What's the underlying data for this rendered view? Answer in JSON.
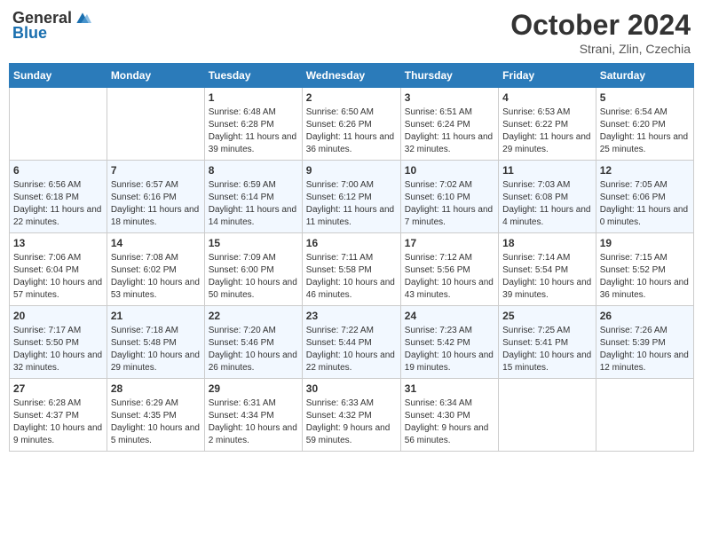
{
  "header": {
    "logo_general": "General",
    "logo_blue": "Blue",
    "month_title": "October 2024",
    "subtitle": "Strani, Zlin, Czechia"
  },
  "weekdays": [
    "Sunday",
    "Monday",
    "Tuesday",
    "Wednesday",
    "Thursday",
    "Friday",
    "Saturday"
  ],
  "weeks": [
    [
      {
        "day": "",
        "info": ""
      },
      {
        "day": "",
        "info": ""
      },
      {
        "day": "1",
        "info": "Sunrise: 6:48 AM\nSunset: 6:28 PM\nDaylight: 11 hours and 39 minutes."
      },
      {
        "day": "2",
        "info": "Sunrise: 6:50 AM\nSunset: 6:26 PM\nDaylight: 11 hours and 36 minutes."
      },
      {
        "day": "3",
        "info": "Sunrise: 6:51 AM\nSunset: 6:24 PM\nDaylight: 11 hours and 32 minutes."
      },
      {
        "day": "4",
        "info": "Sunrise: 6:53 AM\nSunset: 6:22 PM\nDaylight: 11 hours and 29 minutes."
      },
      {
        "day": "5",
        "info": "Sunrise: 6:54 AM\nSunset: 6:20 PM\nDaylight: 11 hours and 25 minutes."
      }
    ],
    [
      {
        "day": "6",
        "info": "Sunrise: 6:56 AM\nSunset: 6:18 PM\nDaylight: 11 hours and 22 minutes."
      },
      {
        "day": "7",
        "info": "Sunrise: 6:57 AM\nSunset: 6:16 PM\nDaylight: 11 hours and 18 minutes."
      },
      {
        "day": "8",
        "info": "Sunrise: 6:59 AM\nSunset: 6:14 PM\nDaylight: 11 hours and 14 minutes."
      },
      {
        "day": "9",
        "info": "Sunrise: 7:00 AM\nSunset: 6:12 PM\nDaylight: 11 hours and 11 minutes."
      },
      {
        "day": "10",
        "info": "Sunrise: 7:02 AM\nSunset: 6:10 PM\nDaylight: 11 hours and 7 minutes."
      },
      {
        "day": "11",
        "info": "Sunrise: 7:03 AM\nSunset: 6:08 PM\nDaylight: 11 hours and 4 minutes."
      },
      {
        "day": "12",
        "info": "Sunrise: 7:05 AM\nSunset: 6:06 PM\nDaylight: 11 hours and 0 minutes."
      }
    ],
    [
      {
        "day": "13",
        "info": "Sunrise: 7:06 AM\nSunset: 6:04 PM\nDaylight: 10 hours and 57 minutes."
      },
      {
        "day": "14",
        "info": "Sunrise: 7:08 AM\nSunset: 6:02 PM\nDaylight: 10 hours and 53 minutes."
      },
      {
        "day": "15",
        "info": "Sunrise: 7:09 AM\nSunset: 6:00 PM\nDaylight: 10 hours and 50 minutes."
      },
      {
        "day": "16",
        "info": "Sunrise: 7:11 AM\nSunset: 5:58 PM\nDaylight: 10 hours and 46 minutes."
      },
      {
        "day": "17",
        "info": "Sunrise: 7:12 AM\nSunset: 5:56 PM\nDaylight: 10 hours and 43 minutes."
      },
      {
        "day": "18",
        "info": "Sunrise: 7:14 AM\nSunset: 5:54 PM\nDaylight: 10 hours and 39 minutes."
      },
      {
        "day": "19",
        "info": "Sunrise: 7:15 AM\nSunset: 5:52 PM\nDaylight: 10 hours and 36 minutes."
      }
    ],
    [
      {
        "day": "20",
        "info": "Sunrise: 7:17 AM\nSunset: 5:50 PM\nDaylight: 10 hours and 32 minutes."
      },
      {
        "day": "21",
        "info": "Sunrise: 7:18 AM\nSunset: 5:48 PM\nDaylight: 10 hours and 29 minutes."
      },
      {
        "day": "22",
        "info": "Sunrise: 7:20 AM\nSunset: 5:46 PM\nDaylight: 10 hours and 26 minutes."
      },
      {
        "day": "23",
        "info": "Sunrise: 7:22 AM\nSunset: 5:44 PM\nDaylight: 10 hours and 22 minutes."
      },
      {
        "day": "24",
        "info": "Sunrise: 7:23 AM\nSunset: 5:42 PM\nDaylight: 10 hours and 19 minutes."
      },
      {
        "day": "25",
        "info": "Sunrise: 7:25 AM\nSunset: 5:41 PM\nDaylight: 10 hours and 15 minutes."
      },
      {
        "day": "26",
        "info": "Sunrise: 7:26 AM\nSunset: 5:39 PM\nDaylight: 10 hours and 12 minutes."
      }
    ],
    [
      {
        "day": "27",
        "info": "Sunrise: 6:28 AM\nSunset: 4:37 PM\nDaylight: 10 hours and 9 minutes."
      },
      {
        "day": "28",
        "info": "Sunrise: 6:29 AM\nSunset: 4:35 PM\nDaylight: 10 hours and 5 minutes."
      },
      {
        "day": "29",
        "info": "Sunrise: 6:31 AM\nSunset: 4:34 PM\nDaylight: 10 hours and 2 minutes."
      },
      {
        "day": "30",
        "info": "Sunrise: 6:33 AM\nSunset: 4:32 PM\nDaylight: 9 hours and 59 minutes."
      },
      {
        "day": "31",
        "info": "Sunrise: 6:34 AM\nSunset: 4:30 PM\nDaylight: 9 hours and 56 minutes."
      },
      {
        "day": "",
        "info": ""
      },
      {
        "day": "",
        "info": ""
      }
    ]
  ]
}
